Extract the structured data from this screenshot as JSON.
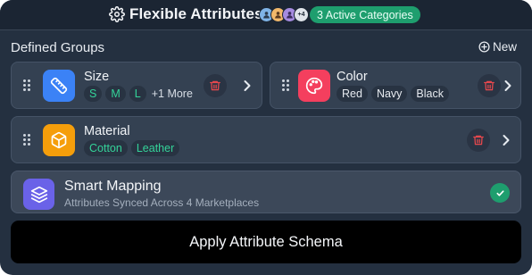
{
  "header": {
    "title": "Flexible Attributes",
    "avatars": [
      {
        "color": "#7fb3e6"
      },
      {
        "color": "#f2b86b"
      },
      {
        "color": "#a58be0"
      }
    ],
    "avatars_more": "+4",
    "active_badge": "3 Active Categories"
  },
  "groups_section": {
    "title": "Defined Groups",
    "new_label": "New"
  },
  "groups": [
    {
      "name": "Size",
      "icon": "ruler-icon",
      "icon_color": "#3b82f6",
      "values": [
        "S",
        "M",
        "L"
      ],
      "more": "+1 More"
    },
    {
      "name": "Color",
      "icon": "palette-icon",
      "icon_color": "#f43f5e",
      "values": [
        "Red",
        "Navy",
        "Black"
      ]
    },
    {
      "name": "Material",
      "icon": "box-icon",
      "icon_color": "#f59e0b",
      "values": [
        "Cotton",
        "Leather"
      ]
    }
  ],
  "smart_mapping": {
    "title": "Smart Mapping",
    "subtitle": "Attributes Synced Across 4 Marketplaces",
    "icon": "layers-icon",
    "status": "check-icon"
  },
  "apply_label": "Apply Attribute Schema",
  "colors": {
    "accent_green": "#1e9e6e",
    "trash_red": "#e5484d"
  }
}
